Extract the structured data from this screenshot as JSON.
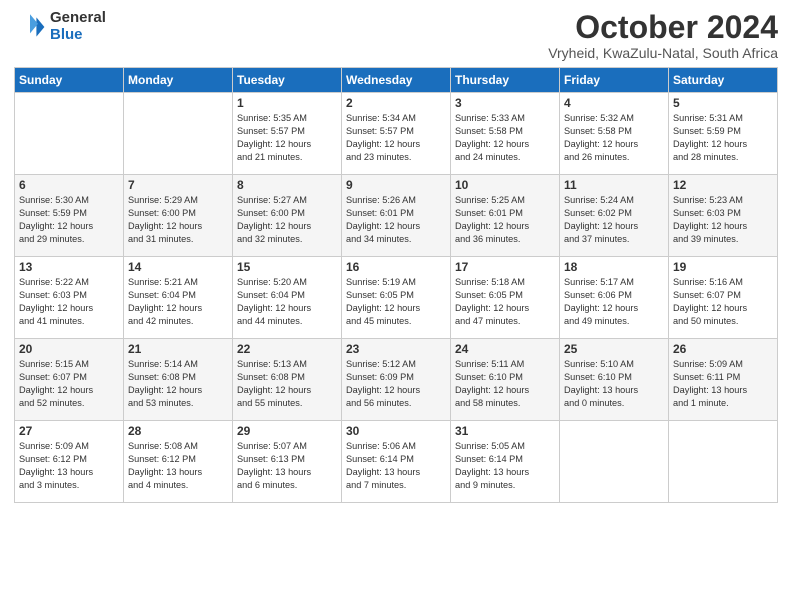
{
  "logo": {
    "general": "General",
    "blue": "Blue"
  },
  "title": "October 2024",
  "location": "Vryheid, KwaZulu-Natal, South Africa",
  "days_of_week": [
    "Sunday",
    "Monday",
    "Tuesday",
    "Wednesday",
    "Thursday",
    "Friday",
    "Saturday"
  ],
  "weeks": [
    [
      {
        "day": "",
        "detail": ""
      },
      {
        "day": "",
        "detail": ""
      },
      {
        "day": "1",
        "detail": "Sunrise: 5:35 AM\nSunset: 5:57 PM\nDaylight: 12 hours\nand 21 minutes."
      },
      {
        "day": "2",
        "detail": "Sunrise: 5:34 AM\nSunset: 5:57 PM\nDaylight: 12 hours\nand 23 minutes."
      },
      {
        "day": "3",
        "detail": "Sunrise: 5:33 AM\nSunset: 5:58 PM\nDaylight: 12 hours\nand 24 minutes."
      },
      {
        "day": "4",
        "detail": "Sunrise: 5:32 AM\nSunset: 5:58 PM\nDaylight: 12 hours\nand 26 minutes."
      },
      {
        "day": "5",
        "detail": "Sunrise: 5:31 AM\nSunset: 5:59 PM\nDaylight: 12 hours\nand 28 minutes."
      }
    ],
    [
      {
        "day": "6",
        "detail": "Sunrise: 5:30 AM\nSunset: 5:59 PM\nDaylight: 12 hours\nand 29 minutes."
      },
      {
        "day": "7",
        "detail": "Sunrise: 5:29 AM\nSunset: 6:00 PM\nDaylight: 12 hours\nand 31 minutes."
      },
      {
        "day": "8",
        "detail": "Sunrise: 5:27 AM\nSunset: 6:00 PM\nDaylight: 12 hours\nand 32 minutes."
      },
      {
        "day": "9",
        "detail": "Sunrise: 5:26 AM\nSunset: 6:01 PM\nDaylight: 12 hours\nand 34 minutes."
      },
      {
        "day": "10",
        "detail": "Sunrise: 5:25 AM\nSunset: 6:01 PM\nDaylight: 12 hours\nand 36 minutes."
      },
      {
        "day": "11",
        "detail": "Sunrise: 5:24 AM\nSunset: 6:02 PM\nDaylight: 12 hours\nand 37 minutes."
      },
      {
        "day": "12",
        "detail": "Sunrise: 5:23 AM\nSunset: 6:03 PM\nDaylight: 12 hours\nand 39 minutes."
      }
    ],
    [
      {
        "day": "13",
        "detail": "Sunrise: 5:22 AM\nSunset: 6:03 PM\nDaylight: 12 hours\nand 41 minutes."
      },
      {
        "day": "14",
        "detail": "Sunrise: 5:21 AM\nSunset: 6:04 PM\nDaylight: 12 hours\nand 42 minutes."
      },
      {
        "day": "15",
        "detail": "Sunrise: 5:20 AM\nSunset: 6:04 PM\nDaylight: 12 hours\nand 44 minutes."
      },
      {
        "day": "16",
        "detail": "Sunrise: 5:19 AM\nSunset: 6:05 PM\nDaylight: 12 hours\nand 45 minutes."
      },
      {
        "day": "17",
        "detail": "Sunrise: 5:18 AM\nSunset: 6:05 PM\nDaylight: 12 hours\nand 47 minutes."
      },
      {
        "day": "18",
        "detail": "Sunrise: 5:17 AM\nSunset: 6:06 PM\nDaylight: 12 hours\nand 49 minutes."
      },
      {
        "day": "19",
        "detail": "Sunrise: 5:16 AM\nSunset: 6:07 PM\nDaylight: 12 hours\nand 50 minutes."
      }
    ],
    [
      {
        "day": "20",
        "detail": "Sunrise: 5:15 AM\nSunset: 6:07 PM\nDaylight: 12 hours\nand 52 minutes."
      },
      {
        "day": "21",
        "detail": "Sunrise: 5:14 AM\nSunset: 6:08 PM\nDaylight: 12 hours\nand 53 minutes."
      },
      {
        "day": "22",
        "detail": "Sunrise: 5:13 AM\nSunset: 6:08 PM\nDaylight: 12 hours\nand 55 minutes."
      },
      {
        "day": "23",
        "detail": "Sunrise: 5:12 AM\nSunset: 6:09 PM\nDaylight: 12 hours\nand 56 minutes."
      },
      {
        "day": "24",
        "detail": "Sunrise: 5:11 AM\nSunset: 6:10 PM\nDaylight: 12 hours\nand 58 minutes."
      },
      {
        "day": "25",
        "detail": "Sunrise: 5:10 AM\nSunset: 6:10 PM\nDaylight: 13 hours\nand 0 minutes."
      },
      {
        "day": "26",
        "detail": "Sunrise: 5:09 AM\nSunset: 6:11 PM\nDaylight: 13 hours\nand 1 minute."
      }
    ],
    [
      {
        "day": "27",
        "detail": "Sunrise: 5:09 AM\nSunset: 6:12 PM\nDaylight: 13 hours\nand 3 minutes."
      },
      {
        "day": "28",
        "detail": "Sunrise: 5:08 AM\nSunset: 6:12 PM\nDaylight: 13 hours\nand 4 minutes."
      },
      {
        "day": "29",
        "detail": "Sunrise: 5:07 AM\nSunset: 6:13 PM\nDaylight: 13 hours\nand 6 minutes."
      },
      {
        "day": "30",
        "detail": "Sunrise: 5:06 AM\nSunset: 6:14 PM\nDaylight: 13 hours\nand 7 minutes."
      },
      {
        "day": "31",
        "detail": "Sunrise: 5:05 AM\nSunset: 6:14 PM\nDaylight: 13 hours\nand 9 minutes."
      },
      {
        "day": "",
        "detail": ""
      },
      {
        "day": "",
        "detail": ""
      }
    ]
  ]
}
